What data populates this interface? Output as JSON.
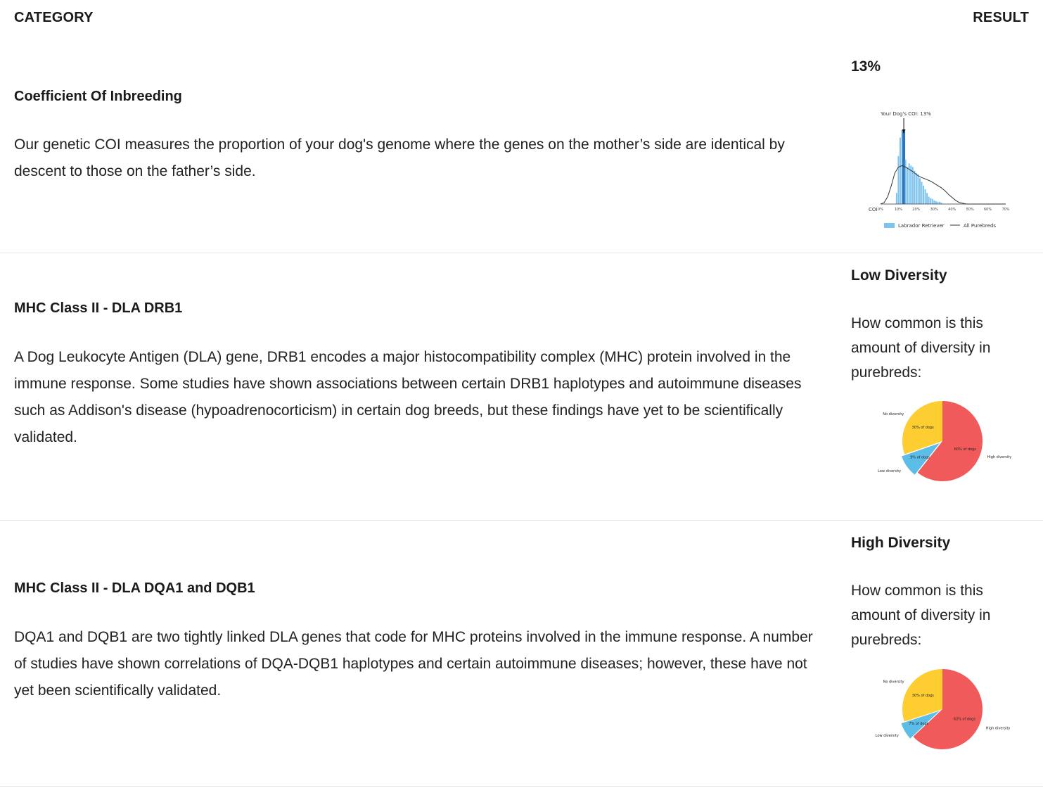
{
  "header": {
    "category_label": "CATEGORY",
    "result_label": "RESULT"
  },
  "rows": [
    {
      "category": "Coefficient Of Inbreeding",
      "description": "Our genetic COI measures the proportion of your dog's genome where the genes on the mother’s side are identical by descent to those on the father’s side.",
      "result": "13%",
      "chart_data": {
        "type": "bar",
        "annotation": "Your Dog's COI: 13%",
        "xlabel": "COI",
        "x_ticks": [
          "0%",
          "10%",
          "20%",
          "30%",
          "40%",
          "50%",
          "60%",
          "70%"
        ],
        "xlim": [
          0,
          70
        ],
        "highlight_x": 13,
        "bar_x": [
          9,
          10,
          11,
          12,
          13,
          14,
          15,
          16,
          17,
          18,
          19,
          20,
          21,
          22,
          23,
          24,
          25,
          26,
          27,
          28,
          29,
          30,
          31,
          32,
          33,
          34
        ],
        "bar_heights": [
          0.15,
          0.65,
          0.9,
          1.0,
          0.98,
          0.6,
          0.5,
          0.55,
          0.52,
          0.5,
          0.45,
          0.42,
          0.4,
          0.35,
          0.3,
          0.25,
          0.2,
          0.15,
          0.1,
          0.08,
          0.07,
          0.05,
          0.04,
          0.03,
          0.03,
          0.02
        ],
        "curve_x": [
          0,
          2,
          4,
          6,
          8,
          10,
          12,
          14,
          16,
          18,
          20,
          22,
          24,
          26,
          28,
          30,
          32,
          34,
          36,
          38,
          40,
          42,
          44,
          46,
          48,
          50,
          70
        ],
        "curve_y": [
          0.0,
          0.02,
          0.1,
          0.25,
          0.42,
          0.5,
          0.52,
          0.5,
          0.47,
          0.44,
          0.4,
          0.37,
          0.35,
          0.33,
          0.31,
          0.28,
          0.25,
          0.22,
          0.18,
          0.13,
          0.09,
          0.05,
          0.02,
          0.01,
          0.0,
          0.0,
          0.0
        ],
        "series": [
          {
            "name": "Labrador Retriever",
            "color": "#7ec3ee"
          },
          {
            "name": "All Purebreds",
            "color": "#333333"
          }
        ],
        "highlight_color": "#2f73b8"
      }
    },
    {
      "category": "MHC Class II - DLA DRB1",
      "description": "A Dog Leukocyte Antigen (DLA) gene, DRB1 encodes a major histocompatibility complex (MHC) protein involved in the immune response. Some studies have shown associations between certain DRB1 haplotypes and autoimmune diseases such as Addison's disease (hypoadrenocorticism) in certain dog breeds, but these findings have yet to be scientifically validated.",
      "result": "Low Diversity",
      "subtext": "How common is this amount of diversity in purebreds:",
      "chart_data": {
        "type": "pie",
        "slices": [
          {
            "label": "High diversity",
            "value": 60,
            "text": "60% of dogs",
            "color": "#f05a5a"
          },
          {
            "label": "Low diversity",
            "value": 9,
            "text": "9% of dogs",
            "color": "#5bbde8"
          },
          {
            "label": "No diversity",
            "value": 30,
            "text": "30% of dogs",
            "color": "#fdcd32"
          }
        ]
      }
    },
    {
      "category": "MHC Class II - DLA DQA1 and DQB1",
      "description": "DQA1 and DQB1 are two tightly linked DLA genes that code for MHC proteins involved in the immune response. A number of studies have shown correlations of DQA-DQB1 haplotypes and certain autoimmune diseases; however, these have not yet been scientifically validated.",
      "result": "High Diversity",
      "subtext": "How common is this amount of diversity in purebreds:",
      "chart_data": {
        "type": "pie",
        "slices": [
          {
            "label": "High diversity",
            "value": 63,
            "text": "63% of dogs",
            "color": "#f05a5a"
          },
          {
            "label": "Low diversity",
            "value": 7,
            "text": "7% of dogs",
            "color": "#5bbde8"
          },
          {
            "label": "No diversity",
            "value": 30,
            "text": "30% of dogs",
            "color": "#fdcd32"
          }
        ]
      }
    }
  ]
}
